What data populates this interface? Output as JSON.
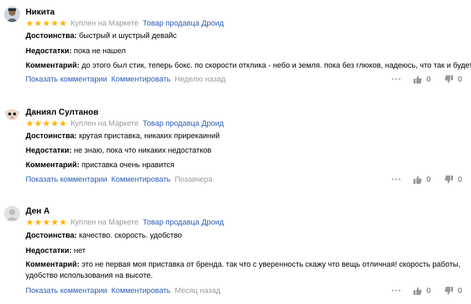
{
  "colors": {
    "star": "#ffb30f",
    "link": "#2a5bb5",
    "muted": "#999999"
  },
  "reviews": [
    {
      "author": "Никита",
      "avatar_icon": "user-avatar-photo",
      "rating": 5,
      "purchased": "Куплен на Маркете",
      "seller": "Товар продавца Дроид",
      "pros_label": "Достоинства:",
      "pros": "быстрый и шустрый девайс",
      "cons_label": "Недостатки:",
      "cons": "пока не нашел",
      "comment_label": "Комментарий:",
      "comment": "до этого был стик, теперь бокс. по скорости отклика - небо и земля. пока без глюков, надеюсь, что так и будет",
      "show_comments": "Показать комментарии",
      "add_comment": "Комментировать",
      "date": "Неделю назад",
      "likes": "0",
      "dislikes": "0"
    },
    {
      "author": "Даниял Султанов",
      "avatar_icon": "user-avatar-photo",
      "rating": 5,
      "purchased": "Куплен на Маркете",
      "seller": "Товар продавца Дроид",
      "pros_label": "Достоинства:",
      "pros": "крутая приставка, никаких прирекаиний",
      "cons_label": "Недостатки:",
      "cons": "не знаю, пока что никаких недостатков",
      "comment_label": "Комментарий:",
      "comment": "приставка очень нравится",
      "show_comments": "Показать комментарии",
      "add_comment": "Комментировать",
      "date": "Позавчера",
      "likes": "0",
      "dislikes": "0"
    },
    {
      "author": "Ден А",
      "avatar_icon": "default-user-avatar",
      "rating": 5,
      "purchased": "Куплен на Маркете",
      "seller": "Товар продавца Дроид",
      "pros_label": "Достоинства:",
      "pros": "качество. скорость. удобство",
      "cons_label": "Недостатки:",
      "cons": "нет",
      "comment_label": "Комментарий:",
      "comment": "это не первая моя приставка от бренда. так что с уверенность скажу что вещь отличная! скорость работы, удобство использования на высоте.",
      "show_comments": "Показать комментарии",
      "add_comment": "Комментировать",
      "date": "Месяц назад",
      "likes": "0",
      "dislikes": "0"
    }
  ]
}
